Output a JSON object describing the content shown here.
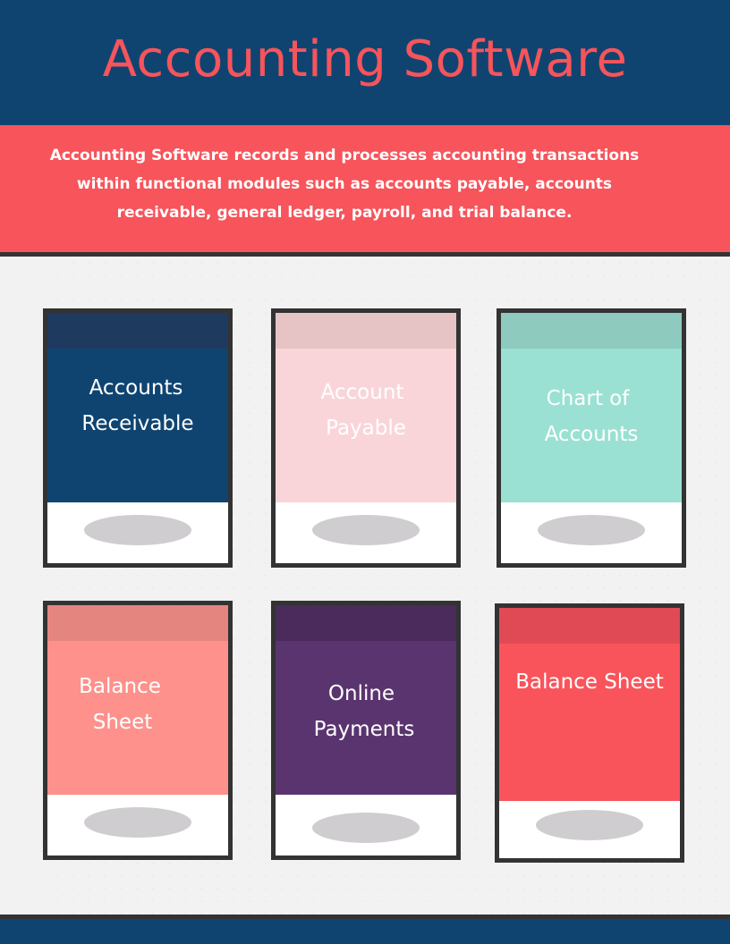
{
  "header": {
    "title": "Accounting Software"
  },
  "description": {
    "line1": "Accounting Software records and processes accounting transactions",
    "line2": "within functional modules such as accounts payable, accounts",
    "line3": "receivable, general ledger, payroll, and trial balance."
  },
  "colors": {
    "navy": "#0f4471",
    "coral": "#f7545b",
    "dark": "#333333"
  },
  "cards": [
    {
      "line1": "Accounts",
      "line2": "Receivable",
      "cap_color": "#1e3a5f",
      "body_color": "#0f4471"
    },
    {
      "line1": "Account",
      "line2": "Payable",
      "cap_color": "#e6c3c5",
      "body_color": "#f9d5d9"
    },
    {
      "line1": "Chart of",
      "line2": "Accounts",
      "cap_color": "#8ecabe",
      "body_color": "#9ae1d3"
    },
    {
      "line1": "Balance",
      "line2": "Sheet",
      "cap_color": "#e5857f",
      "body_color": "#fe918b"
    },
    {
      "line1": "Online",
      "line2": "Payments",
      "cap_color": "#4a2b5c",
      "body_color": "#5a346f"
    },
    {
      "line1": "Balance Sheet",
      "line2": "",
      "cap_color": "#e04a54",
      "body_color": "#f9545b"
    }
  ]
}
